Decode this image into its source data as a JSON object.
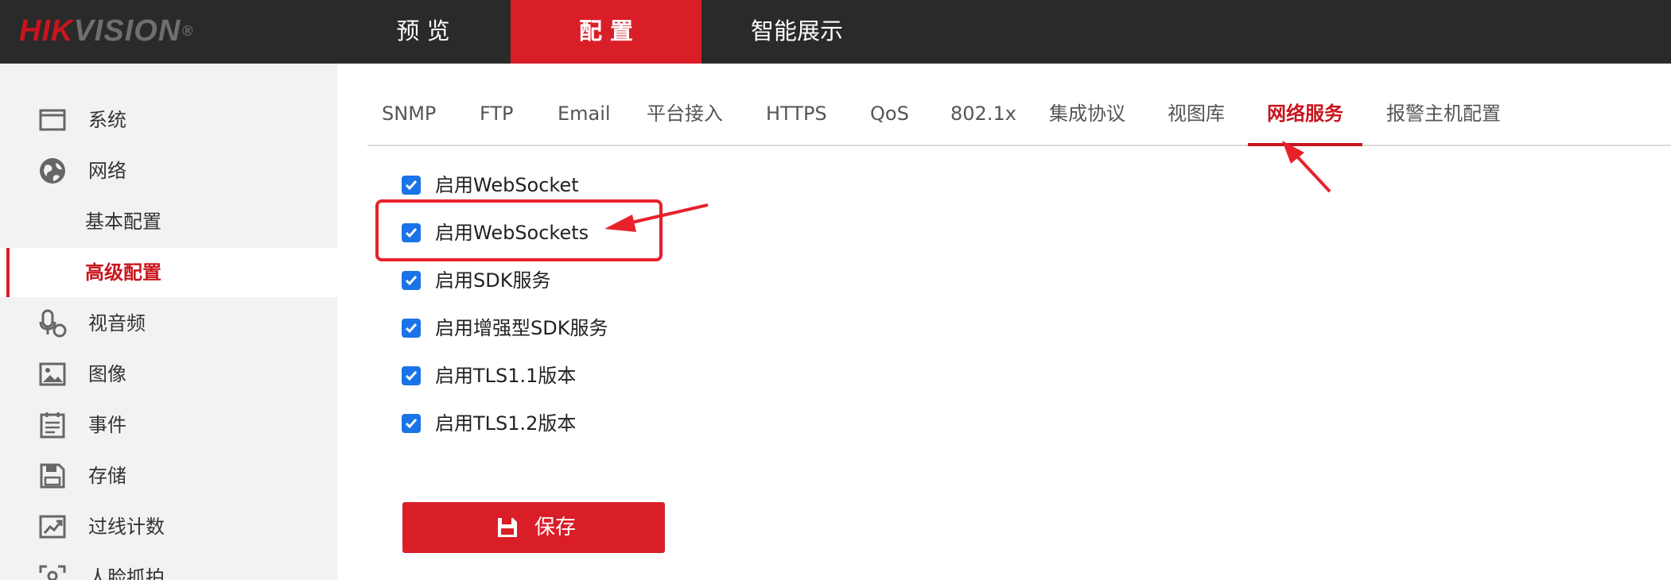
{
  "brand": {
    "hik": "HIK",
    "vision": "VISION",
    "reg": "®"
  },
  "topnav": [
    {
      "label": "预 览"
    },
    {
      "label": "配 置"
    },
    {
      "label": "智能展示"
    }
  ],
  "sidebar": {
    "items": [
      {
        "label": "系统",
        "icon": "monitor-icon"
      },
      {
        "label": "网络",
        "icon": "globe-icon"
      },
      {
        "label": "基本配置"
      },
      {
        "label": "高级配置",
        "active": true
      },
      {
        "label": "视音频",
        "icon": "video-audio-icon"
      },
      {
        "label": "图像",
        "icon": "image-icon"
      },
      {
        "label": "事件",
        "icon": "event-icon"
      },
      {
        "label": "存储",
        "icon": "storage-icon"
      },
      {
        "label": "过线计数",
        "icon": "line-count-icon"
      },
      {
        "label": "人脸抓拍",
        "icon": "face-capture-icon"
      }
    ]
  },
  "tabs": [
    {
      "label": "SNMP"
    },
    {
      "label": "FTP"
    },
    {
      "label": "Email"
    },
    {
      "label": "平台接入"
    },
    {
      "label": "HTTPS"
    },
    {
      "label": "QoS"
    },
    {
      "label": "802.1x"
    },
    {
      "label": "集成协议"
    },
    {
      "label": "视图库"
    },
    {
      "label": "网络服务",
      "active": true
    },
    {
      "label": "报警主机配置"
    }
  ],
  "options": [
    {
      "label": "启用WebSocket",
      "checked": true
    },
    {
      "label": "启用WebSockets",
      "checked": true
    },
    {
      "label": "启用SDK服务",
      "checked": true
    },
    {
      "label": "启用增强型SDK服务",
      "checked": true
    },
    {
      "label": "启用TLS1.1版本",
      "checked": true
    },
    {
      "label": "启用TLS1.2版本",
      "checked": true
    }
  ],
  "save": {
    "label": "保存",
    "icon": "save-icon"
  },
  "colors": {
    "brand_red": "#da1e28",
    "checkbox_blue": "#1a73e8",
    "annotation_red": "#e8212b"
  }
}
